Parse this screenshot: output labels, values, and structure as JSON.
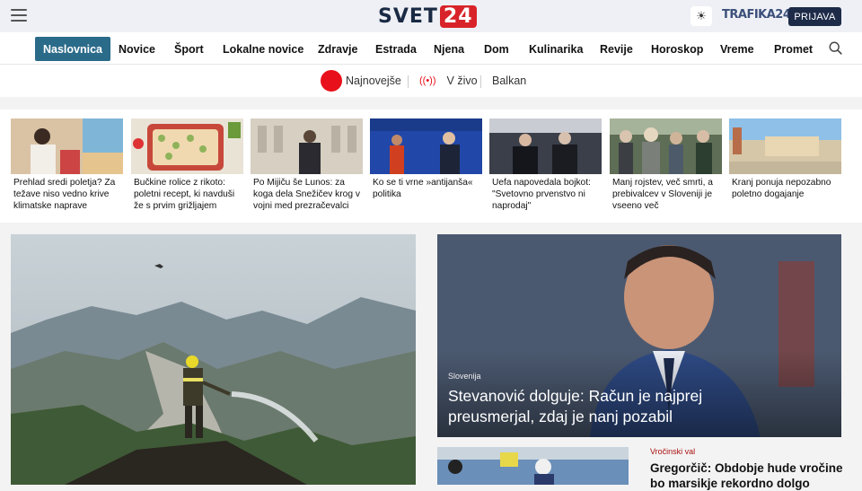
{
  "header": {
    "logo_text": "SVET",
    "logo_number": "24",
    "trafika": "TRAFIKA24",
    "login": "PRIJAVA"
  },
  "nav": {
    "items": [
      "Naslovnica",
      "Novice",
      "Šport",
      "Lokalne novice",
      "Zdravje",
      "Estrada",
      "Njena",
      "Dom",
      "Kulinarika",
      "Revije",
      "Horoskop",
      "Vreme",
      "Promet"
    ],
    "active": "Naslovnica"
  },
  "subnav": {
    "latest": "Najnovejše",
    "live": "V živo",
    "balkan": "Balkan"
  },
  "teasers": [
    {
      "title": "Prehlad sredi poletja? Za težave niso vedno krive klimatske naprave"
    },
    {
      "title": "Bučkine rolice z rikoto: poletni recept, ki navduši že s prvim grižljajem"
    },
    {
      "title": "Po Mijiču še Lunos: za koga dela Snežičev krog v vojni med prezračevalci"
    },
    {
      "title": "Ko se ti vrne »antijanša« politika"
    },
    {
      "title": "Uefa napovedala bojkot: \"Svetovno prvenstvo ni naprodaj\""
    },
    {
      "title": "Manj rojstev, več smrti, a prebivalcev v Sloveniji je vseeno več"
    },
    {
      "title": "Kranj ponuja nepozabno poletno dogajanje"
    }
  ],
  "hero_right": {
    "category": "Slovenija",
    "title": "Stevanović dolguje: Račun je najprej preusmerjal, zdaj je nanj pozabil"
  },
  "bottom": {
    "category": "Vročinski val",
    "title": "Gregorčič: Obdobje hude vročine bo marsikje rekordno dolgo"
  },
  "colors": {
    "accent_nav": "#2b6b8a",
    "brand_red": "#d8232a",
    "login_bg": "#1d2b49"
  }
}
